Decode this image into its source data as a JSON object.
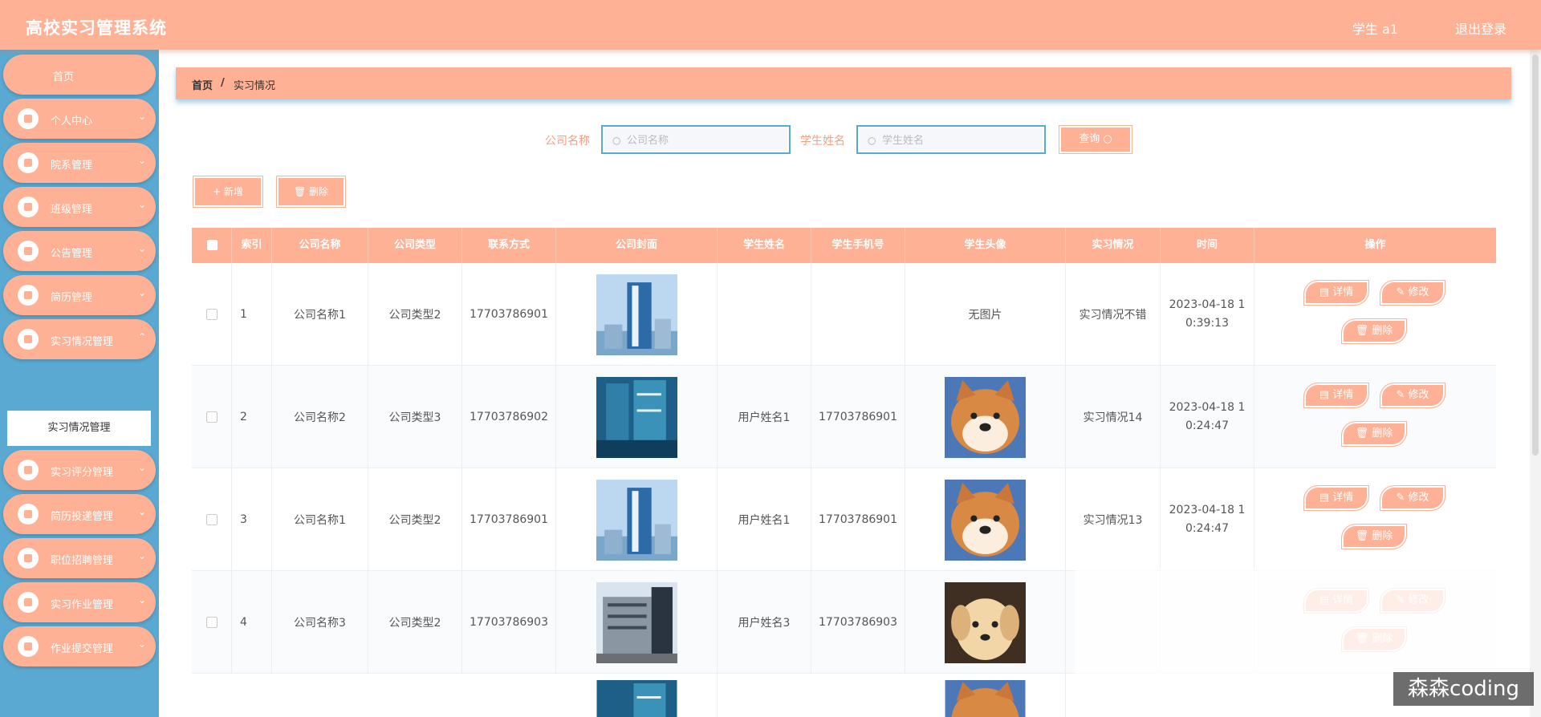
{
  "header": {
    "title": "高校实习管理系统",
    "user": "学生 a1",
    "logout": "退出登录"
  },
  "sidebar": {
    "home": "首页",
    "items": [
      {
        "label": "个人中心",
        "icon": "user-icon"
      },
      {
        "label": "院系管理",
        "icon": "building-icon"
      },
      {
        "label": "班级管理",
        "icon": "monitor-icon"
      },
      {
        "label": "公告管理",
        "icon": "grid-icon"
      },
      {
        "label": "简历管理",
        "icon": "grid-icon"
      },
      {
        "label": "实习情况管理",
        "icon": "monitor-icon"
      },
      {
        "label": "实习评分管理",
        "icon": "monitor-icon"
      },
      {
        "label": "简历投递管理",
        "icon": "grid-icon"
      },
      {
        "label": "职位招聘管理",
        "icon": "send-icon"
      },
      {
        "label": "实习作业管理",
        "icon": "grid-icon"
      },
      {
        "label": "作业提交管理",
        "icon": "monitor-icon"
      }
    ],
    "active_sub": "实习情况管理"
  },
  "breadcrumb": {
    "home": "首页",
    "separator": "/",
    "current": "实习情况"
  },
  "search": {
    "company_label": "公司名称",
    "company_placeholder": "公司名称",
    "student_label": "学生姓名",
    "student_placeholder": "学生姓名",
    "query_label": "查询"
  },
  "toolbar": {
    "add_label": "+ 新增",
    "delete_label": "删除"
  },
  "table": {
    "columns": [
      "索引",
      "公司名称",
      "公司类型",
      "联系方式",
      "公司封面",
      "学生姓名",
      "学生手机号",
      "学生头像",
      "实习情况",
      "时间",
      "操作"
    ],
    "rows": [
      {
        "index": "1",
        "company": "公司名称1",
        "type": "公司类型2",
        "contact": "17703786901",
        "cover": "blue-tower",
        "student": "",
        "phone": "",
        "avatar": "无图片",
        "status": "实习情况不错",
        "time": "2023-04-18 10:39:13"
      },
      {
        "index": "2",
        "company": "公司名称2",
        "type": "公司类型3",
        "contact": "17703786902",
        "cover": "teal-building",
        "student": "用户姓名1",
        "phone": "17703786901",
        "avatar": "shiba-dog",
        "status": "实习情况14",
        "time": "2023-04-18 10:24:47"
      },
      {
        "index": "3",
        "company": "公司名称1",
        "type": "公司类型2",
        "contact": "17703786901",
        "cover": "blue-tower",
        "student": "用户姓名1",
        "phone": "17703786901",
        "avatar": "shiba-dog",
        "status": "实习情况13",
        "time": "2023-04-18 10:24:47"
      },
      {
        "index": "4",
        "company": "公司名称3",
        "type": "公司类型2",
        "contact": "17703786903",
        "cover": "office-building",
        "student": "用户姓名3",
        "phone": "17703786903",
        "avatar": "puppy",
        "status": "",
        "time": ""
      }
    ],
    "actions": {
      "detail": "详情",
      "edit": "修改",
      "delete": "删除"
    }
  },
  "watermark": "森森coding",
  "colors": {
    "primary": "#ffb196",
    "sidebar": "#5aa9d2",
    "label": "#f0a088"
  }
}
